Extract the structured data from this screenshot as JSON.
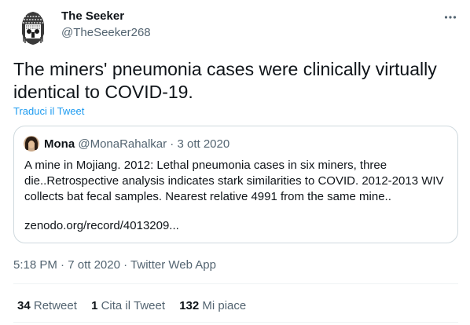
{
  "author": {
    "name": "The Seeker",
    "handle": "@TheSeeker268"
  },
  "tweet": {
    "text": "The miners' pneumonia cases were clinically virtually identical to COVID-19.",
    "translate_label": "Traduci il Tweet"
  },
  "quoted": {
    "name": "Mona",
    "handle": "@MonaRahalkar",
    "separator": "·",
    "date": "3 ott 2020",
    "text": "A mine in Mojiang. 2012: Lethal pneumonia cases in six miners, three die..Retrospective analysis indicates stark similarities to COVID. 2012-2013 WIV collects bat fecal samples. Nearest relative 4991 from the same mine..",
    "link": "zenodo.org/record/4013209..."
  },
  "meta": {
    "time": "5:18 PM",
    "separator": "·",
    "date": "7 ott 2020",
    "app": "Twitter Web App"
  },
  "stats": [
    {
      "count": "34",
      "label": "Retweet"
    },
    {
      "count": "1",
      "label": "Cita il Tweet"
    },
    {
      "count": "132",
      "label": "Mi piace"
    }
  ],
  "icons": {
    "more": "more-horizontal-icon",
    "avatar": "tribal-mask-avatar",
    "quoted_avatar": "profile-photo-avatar"
  }
}
